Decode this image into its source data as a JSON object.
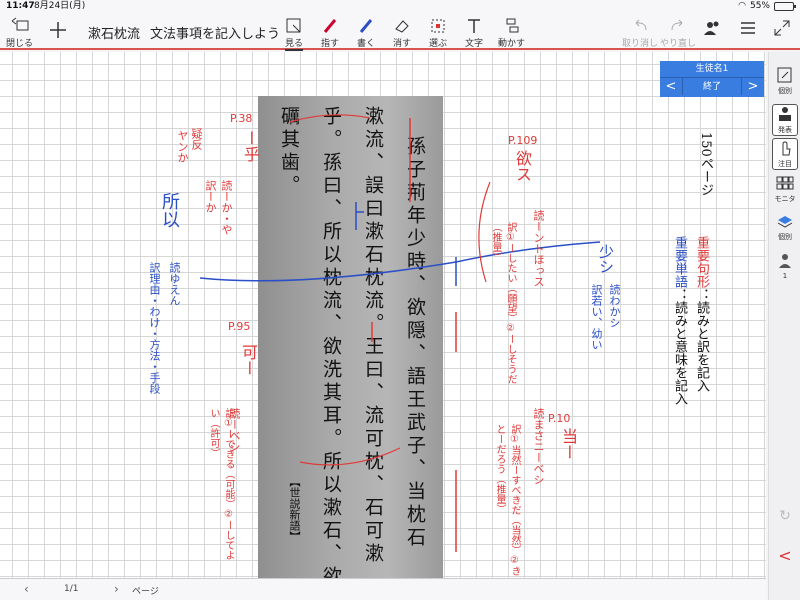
{
  "status": {
    "time": "11:47",
    "date": "8月24日(月)",
    "battery": "55%",
    "battery_level": 0.55
  },
  "toolbar": {
    "close_label": "閉じる",
    "title_main": "漱石枕流",
    "title_sub": "文法事項を記入しよう",
    "tools": [
      {
        "label": "見る"
      },
      {
        "label": "指す"
      },
      {
        "label": "書く"
      },
      {
        "label": "消す"
      },
      {
        "label": "選ぶ"
      },
      {
        "label": "文字"
      },
      {
        "label": "動かす"
      }
    ],
    "undo_label": "取り消し",
    "redo_label": "やり直し"
  },
  "student_panel": {
    "name": "生徒名1",
    "prev": "<",
    "end": "終了",
    "next": ">"
  },
  "sidebar": {
    "items": [
      {
        "label": "個別"
      },
      {
        "label": "発表"
      },
      {
        "label": "注目"
      },
      {
        "label": "モニタ"
      },
      {
        "label": "個別"
      },
      {
        "label": "1"
      }
    ],
    "collapse": "<"
  },
  "page": {
    "page_ref": "150ページ",
    "legend_1": "重要句形：読みと訳を記入",
    "legend_1_head": "重要句形",
    "legend_1_tail": "：読みと訳を記入",
    "legend_2_head": "重要単語",
    "legend_2_tail": "：読みと意味を記入",
    "source": "【世説新語】",
    "text_columns": [
      "孫子荊年少時、欲隠、語王武子、当枕石",
      "漱流、誤曰漱石枕流。王曰、流可枕、石可漱",
      "乎。孫曰、所以枕流、欲洗其耳。所以漱石、欲",
      "礪其歯。"
    ],
    "annotations": {
      "p38": "P.38",
      "hu": "ー乎",
      "hu_read": "読ーか・や",
      "hu_trans": "訳ーか",
      "hu_side": "疑反",
      "hu_side2": "ヤンか",
      "shoi": "所以",
      "shoi_read": "読ゆえん",
      "shoi_mean": "訳理由・わけ・方法・手段",
      "p95": "P.95",
      "ka": "可ー",
      "ka_read": "読ーベシ",
      "ka_trans": "訳①ーできる（可能）②ーしてよい（許可）",
      "p109": "P.109",
      "yoku": "欲ス",
      "yoku_read": "読ーントほっス",
      "yoku_trans": "訳①ーしたい（願望）②ーしそうだ（推量）",
      "shou": "少シ",
      "shou_read": "読わかシ",
      "shou_mean": "訳若い、幼い",
      "p10": "P.10",
      "tou": "当ー",
      "tou_read": "読まさニーベシ",
      "tou_trans": "訳①当然ーすべきだ（当然）②きっとーだろう（推量）"
    }
  },
  "footer": {
    "page": "1/1",
    "unit": "ページ"
  },
  "colors": {
    "red": "#e03a3a",
    "blue": "#2a4fc6",
    "accent": "#3a7de0"
  }
}
